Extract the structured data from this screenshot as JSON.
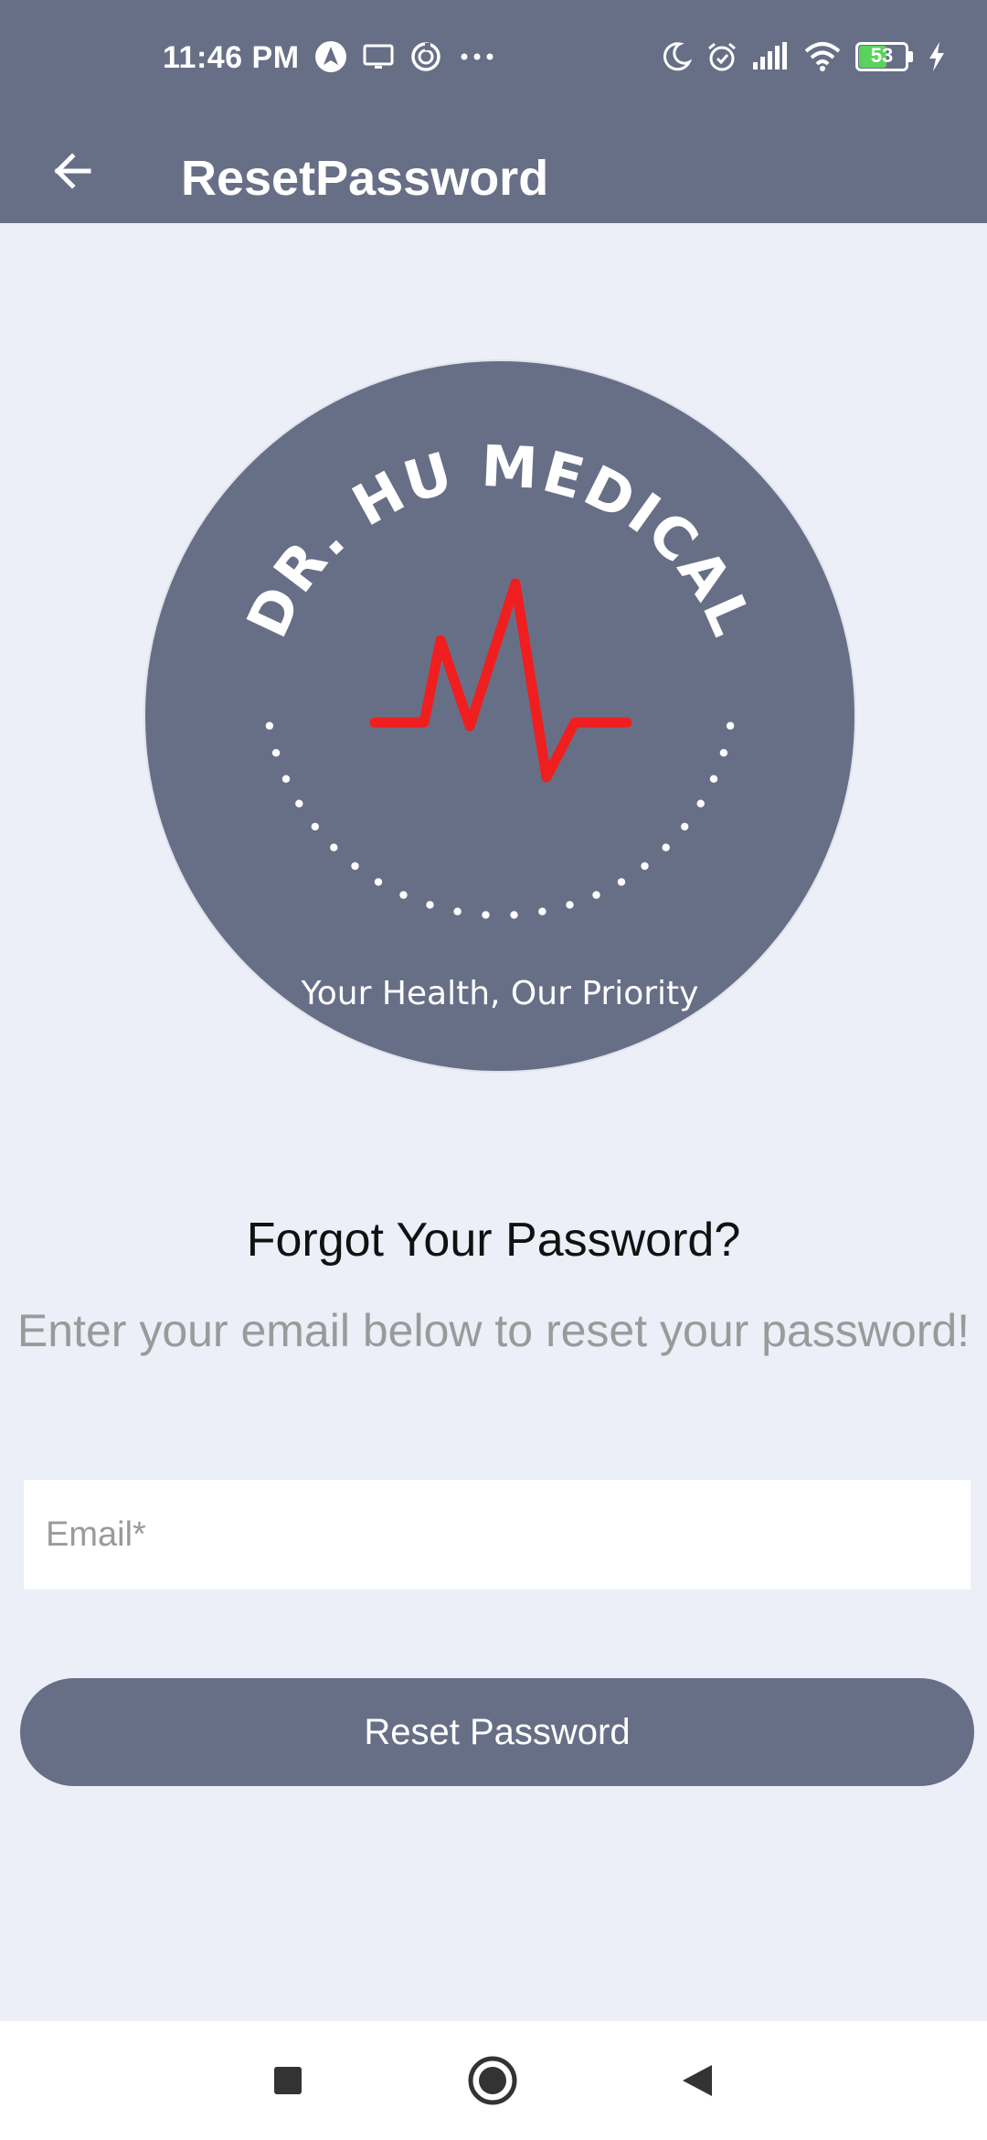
{
  "status_bar": {
    "time": "11:46 PM",
    "battery_level": "53",
    "left_icons": [
      "navigation-arrow-icon",
      "screen-cast-icon",
      "sync-icon",
      "more-dots-icon"
    ],
    "right_icons": [
      "moon-icon",
      "alarm-icon",
      "signal-icon",
      "wifi-icon",
      "battery-icon",
      "charging-bolt-icon"
    ]
  },
  "app_bar": {
    "title": "ResetPassword",
    "back_icon": "arrow-left-icon"
  },
  "logo": {
    "brand": "DR. HU MEDICAL",
    "tagline": "Your Health, Our Priority",
    "colors": {
      "circle": "#676F87",
      "pulse": "#F01E1E",
      "text": "#FFFFFF"
    }
  },
  "content": {
    "heading": "Forgot Your Password?",
    "subheading": "Enter your email below to reset your password!"
  },
  "form": {
    "email_placeholder": "Email*",
    "email_value": "",
    "submit_label": "Reset Password"
  },
  "theme": {
    "primary": "#676F87",
    "background": "#ECEEF8"
  },
  "nav_bar": {
    "icons": [
      "recent-apps-icon",
      "home-icon",
      "back-icon"
    ]
  }
}
